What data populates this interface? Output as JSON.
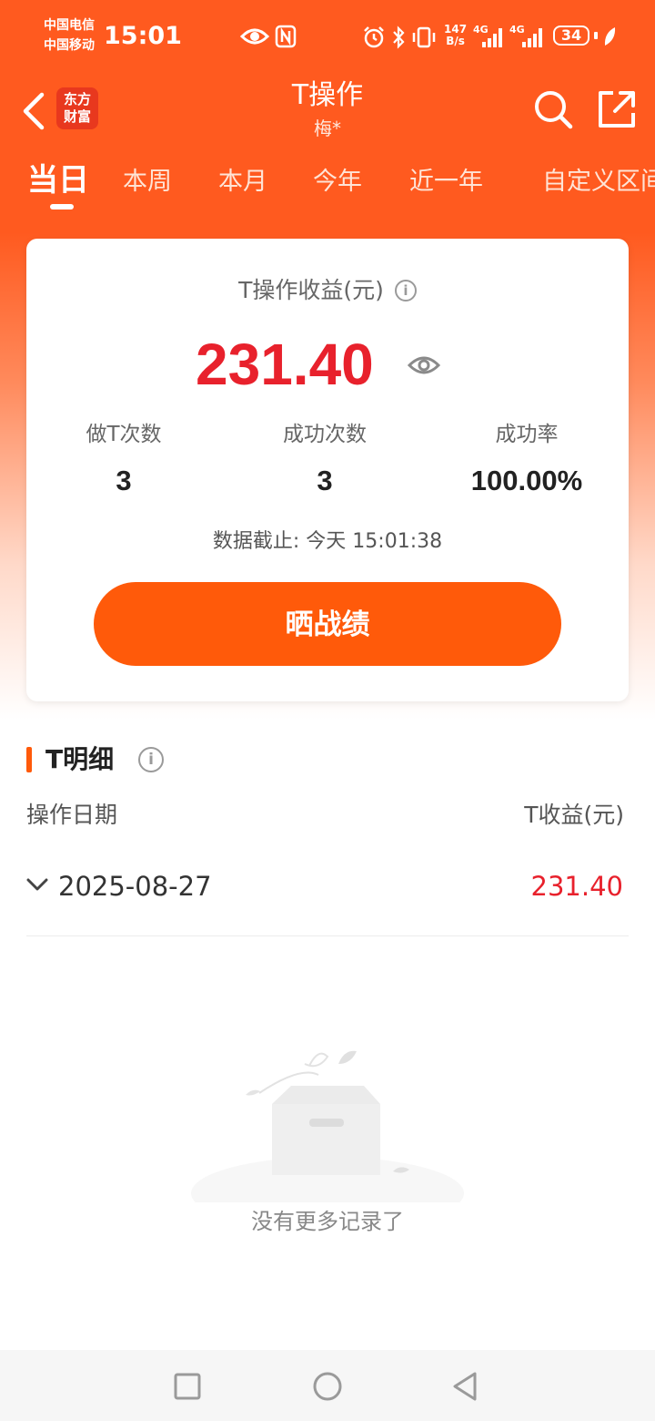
{
  "status_bar": {
    "carrier_1": "中国电信",
    "carrier_2": "中国移动",
    "time": "15:01",
    "net_speed_value": "147",
    "net_speed_unit": "B/s",
    "battery": "34",
    "icons": [
      "eye-icon",
      "nfc-icon",
      "alarm-icon",
      "bluetooth-icon",
      "vibrate-icon",
      "signal-4g-icon",
      "signal-4g-icon",
      "leaf-icon"
    ]
  },
  "header": {
    "logo_line1": "东方",
    "logo_line2": "财富",
    "title": "T操作",
    "subtitle": "梅*",
    "actions": [
      "search-icon",
      "share-icon"
    ]
  },
  "tabs": [
    {
      "label": "当日",
      "active": true
    },
    {
      "label": "本周",
      "active": false
    },
    {
      "label": "本月",
      "active": false
    },
    {
      "label": "今年",
      "active": false
    },
    {
      "label": "近一年",
      "active": false
    },
    {
      "label": "自定义区间",
      "active": false
    }
  ],
  "summary": {
    "label": "T操作收益(元)",
    "profit": "231.40",
    "stats": [
      {
        "label": "做T次数",
        "value": "3"
      },
      {
        "label": "成功次数",
        "value": "3"
      },
      {
        "label": "成功率",
        "value": "100.00%"
      }
    ],
    "data_time": "数据截止: 今天 15:01:38",
    "share_button": "晒战绩"
  },
  "detail": {
    "title": "T明细",
    "col_date": "操作日期",
    "col_profit": "T收益(元)",
    "rows": [
      {
        "date": "2025-08-27",
        "profit": "231.40"
      }
    ]
  },
  "empty_state": {
    "text": "没有更多记录了"
  },
  "colors": {
    "brand_orange": "#ff5a0a",
    "profit_red": "#e8212c"
  }
}
